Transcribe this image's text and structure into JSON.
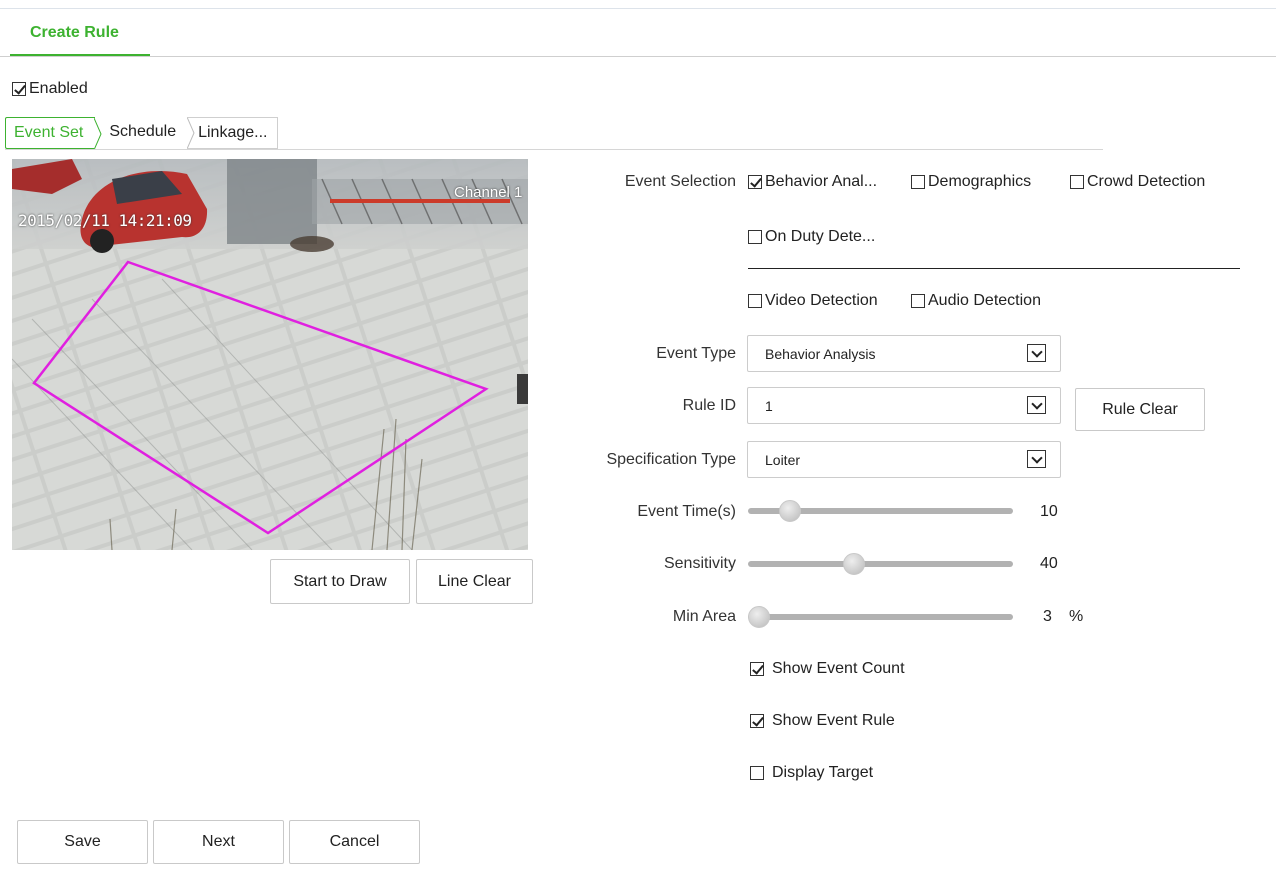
{
  "header": {
    "title": "Create Rule"
  },
  "enabled": {
    "label": "Enabled",
    "checked": true
  },
  "steps": [
    "Event Set",
    "Schedule",
    "Linkage..."
  ],
  "video": {
    "timestamp": "2015/02/11 14:21:09",
    "channel": "Channel 1"
  },
  "draw_buttons": {
    "start": "Start to Draw",
    "clear": "Line Clear"
  },
  "event_selection": {
    "label": "Event Selection",
    "options": [
      {
        "label": "Behavior Anal...",
        "checked": true
      },
      {
        "label": "Demographics",
        "checked": false
      },
      {
        "label": "Crowd Detection",
        "checked": false
      },
      {
        "label": "On Duty Dete...",
        "checked": false
      },
      {
        "label": "Video Detection",
        "checked": false
      },
      {
        "label": "Audio Detection",
        "checked": false
      }
    ]
  },
  "event_type": {
    "label": "Event Type",
    "value": "Behavior Analysis"
  },
  "rule_id": {
    "label": "Rule ID",
    "value": "1",
    "clear_label": "Rule Clear"
  },
  "spec_type": {
    "label": "Specification Type",
    "value": "Loiter"
  },
  "event_time": {
    "label": "Event Time(s)",
    "value": "10",
    "level": 0.16
  },
  "sensitivity": {
    "label": "Sensitivity",
    "value": "40",
    "level": 0.4
  },
  "min_area": {
    "label": "Min Area",
    "value": "3",
    "unit": "%",
    "level": 0.03
  },
  "options": {
    "show_event_count": {
      "label": "Show Event Count",
      "checked": true
    },
    "show_event_rule": {
      "label": "Show Event Rule",
      "checked": true
    },
    "display_target": {
      "label": "Display Target",
      "checked": false
    }
  },
  "footer": {
    "save": "Save",
    "next": "Next",
    "cancel": "Cancel"
  },
  "colors": {
    "accent": "#3db230",
    "region": "#e020e0"
  }
}
